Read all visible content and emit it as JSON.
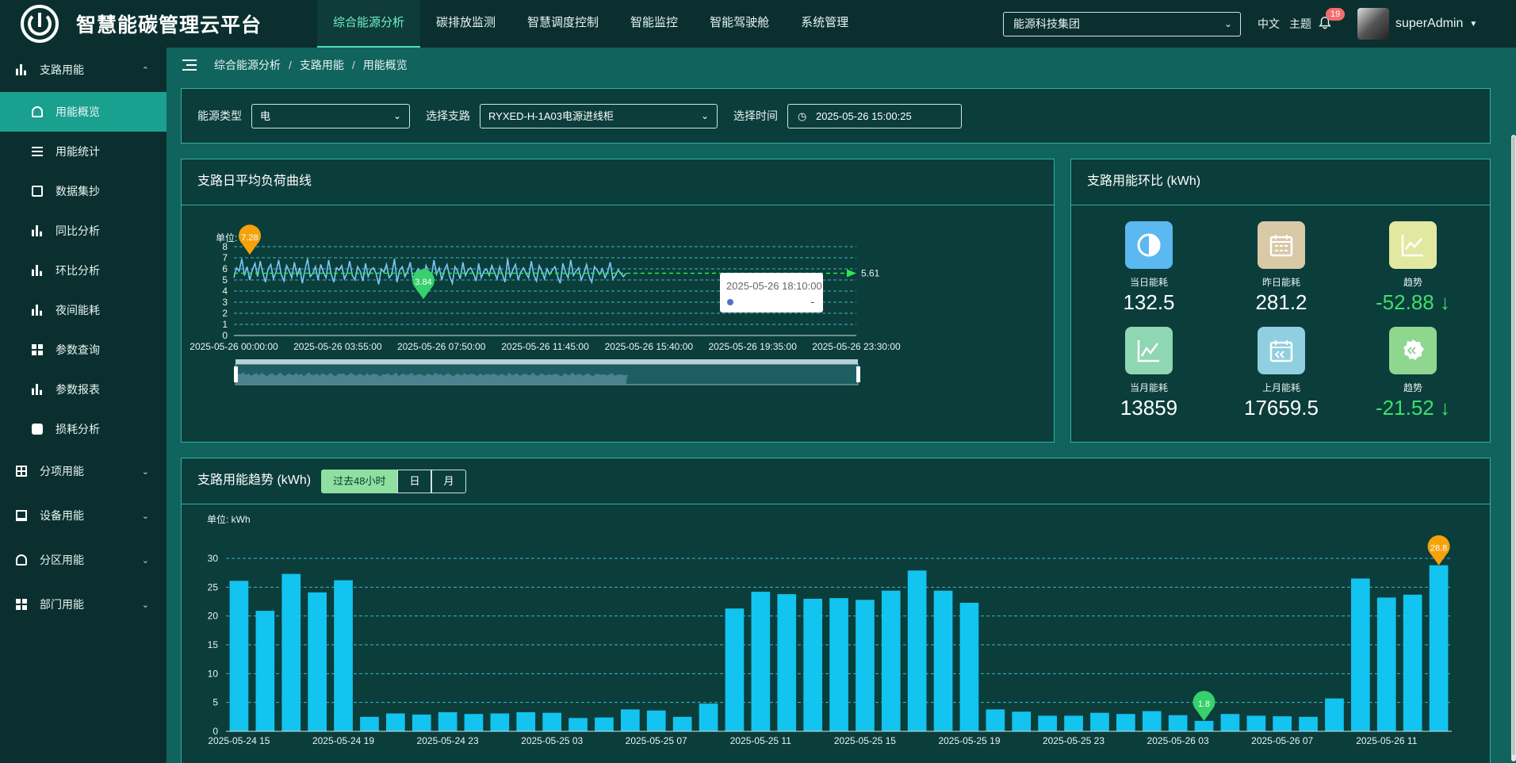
{
  "app": {
    "title": "智慧能碳管理云平台"
  },
  "topnav": [
    "综合能源分析",
    "碳排放监测",
    "智慧调度控制",
    "智能监控",
    "智能驾驶舱",
    "系统管理"
  ],
  "header": {
    "org": "能源科技集团",
    "lang": "中文",
    "theme": "主题",
    "notifications": "19",
    "user": "superAdmin"
  },
  "sidebar": {
    "group1": "支路用能",
    "items": [
      "用能概览",
      "用能统计",
      "数据集抄",
      "同比分析",
      "环比分析",
      "夜间能耗",
      "参数查询",
      "参数报表",
      "损耗分析"
    ],
    "groups": [
      "分项用能",
      "设备用能",
      "分区用能",
      "部门用能"
    ]
  },
  "breadcrumb": [
    "综合能源分析",
    "支路用能",
    "用能概览"
  ],
  "filters": {
    "energy_label": "能源类型",
    "energy_value": "电",
    "branch_label": "选择支路",
    "branch_value": "RYXED-H-1A03电源进线柜",
    "time_label": "选择时间",
    "time_value": "2025-05-26 15:00:25"
  },
  "load_panel": {
    "title": "支路日平均负荷曲线",
    "unit": "单位:",
    "max_label": "7.28",
    "min_label": "3.84",
    "avg_label": "5.61",
    "tooltip_time": "2025-05-26 18:10:00",
    "tooltip_value": "-"
  },
  "ratio_panel": {
    "title": "支路用能环比 (kWh)",
    "kpis": [
      {
        "label": "当日能耗",
        "value": "132.5"
      },
      {
        "label": "昨日能耗",
        "value": "281.2"
      },
      {
        "label": "趋势",
        "value": "-52.88 ↓"
      },
      {
        "label": "当月能耗",
        "value": "13859"
      },
      {
        "label": "上月能耗",
        "value": "17659.5"
      },
      {
        "label": "趋势",
        "value": "-21.52 ↓"
      }
    ],
    "colors": {
      "down": "#3be06c"
    }
  },
  "trend_panel": {
    "title": "支路用能趋势 (kWh)",
    "tabs": [
      "过去48小时",
      "日",
      "月"
    ],
    "unit": "单位: kWh",
    "max_label": "28.8",
    "min_label": "1.8"
  },
  "chart_data": [
    {
      "type": "line",
      "title": "支路日平均负荷曲线",
      "ylabel": "单位:",
      "ylim": [
        0,
        8
      ],
      "yticks": [
        0,
        1,
        2,
        3,
        4,
        5,
        6,
        7,
        8
      ],
      "xticks": [
        "2025-05-26 00:00:00",
        "2025-05-26 03:55:00",
        "2025-05-26 07:50:00",
        "2025-05-26 11:45:00",
        "2025-05-26 15:40:00",
        "2025-05-26 19:35:00",
        "2025-05-26 23:30:00"
      ],
      "x_range_minutes": [
        0,
        1410
      ],
      "series": [
        {
          "values": [
            5.2,
            6.1,
            5.8,
            6.9,
            5.4,
            6.2,
            5.0,
            5.9,
            6.5,
            5.3,
            6.7,
            5.6,
            4.8,
            6.0,
            6.4,
            5.1,
            5.7,
            6.8,
            5.5,
            4.9,
            6.3,
            5.8,
            5.2,
            6.6,
            5.4,
            6.1,
            4.7,
            5.9,
            6.9,
            5.3,
            5.6,
            6.2,
            5.0,
            6.4,
            5.7,
            5.2,
            6.8,
            5.5,
            4.8,
            6.1,
            5.9,
            6.3,
            5.1,
            5.6,
            6.7,
            5.4,
            5.0,
            6.2,
            5.8,
            4.9,
            6.5,
            5.3,
            5.9,
            6.1,
            5.6,
            4.6,
            6.0,
            5.7,
            6.4,
            5.2,
            5.5,
            6.9,
            4.8,
            5.9,
            6.2,
            5.3,
            5.8,
            6.6,
            5.1,
            5.6,
            6.0,
            5.4,
            4.9,
            6.3,
            5.7,
            5.2,
            6.8,
            5.5,
            6.1,
            5.0,
            5.9,
            6.4,
            5.3,
            4.7,
            6.2,
            5.8,
            5.1,
            6.6,
            5.4,
            5.9,
            6.1,
            5.6,
            4.9,
            6.5,
            5.2,
            5.8,
            6.0,
            5.4,
            6.3,
            5.7,
            5.1,
            6.2,
            5.5,
            4.8,
            6.9,
            5.3,
            5.9,
            6.4,
            5.0,
            5.7,
            6.1,
            5.6,
            5.2,
            6.7,
            5.4,
            4.9,
            6.3,
            5.8,
            5.1,
            6.0,
            5.5,
            5.9,
            6.2,
            5.3,
            4.7,
            6.5,
            5.7,
            5.2,
            6.8,
            5.4,
            5.8,
            6.1,
            5.0,
            5.6,
            6.4,
            5.3,
            4.8,
            6.2,
            5.9,
            5.5,
            6.0,
            5.2,
            5.7,
            6.6,
            5.1,
            5.4,
            5.9,
            5.6,
            5.3,
            5.6
          ]
        }
      ],
      "markers": {
        "max": 7.28,
        "min": 3.84,
        "average": 5.61
      }
    },
    {
      "type": "bar",
      "title": "支路用能趋势 (kWh)",
      "ylabel": "单位: kWh",
      "ylim": [
        0,
        30
      ],
      "yticks": [
        0,
        5,
        10,
        15,
        20,
        25,
        30
      ],
      "xtick_labels": [
        "2025-05-24 15",
        "2025-05-24 19",
        "2025-05-24 23",
        "2025-05-25 03",
        "2025-05-25 07",
        "2025-05-25 11",
        "2025-05-25 15",
        "2025-05-25 19",
        "2025-05-25 23",
        "2025-05-26 03",
        "2025-05-26 07",
        "2025-05-26 11"
      ],
      "values": [
        26.1,
        20.9,
        27.3,
        24.1,
        26.2,
        2.5,
        3.1,
        2.9,
        3.3,
        3.0,
        3.1,
        3.3,
        3.2,
        2.3,
        2.4,
        3.8,
        3.6,
        2.5,
        4.8,
        21.3,
        24.2,
        23.8,
        23.0,
        23.1,
        22.8,
        24.4,
        27.9,
        24.4,
        22.3,
        3.8,
        3.4,
        2.7,
        2.7,
        3.2,
        3.0,
        3.5,
        2.8,
        1.8,
        3.0,
        2.7,
        2.6,
        2.5,
        5.7,
        26.5,
        23.2,
        23.7,
        28.8
      ],
      "markers": {
        "max": 28.8,
        "min": 1.8
      }
    }
  ]
}
